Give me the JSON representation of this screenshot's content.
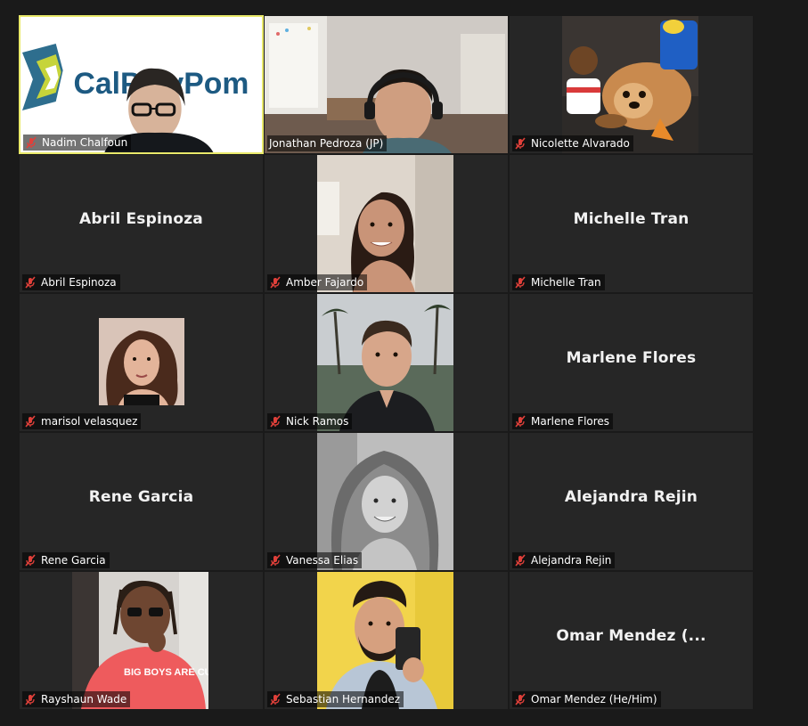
{
  "participants": [
    {
      "display_name": "Nadim Chalfoun",
      "center_text": "",
      "mic_icon": "mic-muted-icon",
      "active_speaker": true
    },
    {
      "display_name": "Jonathan Pedroza (JP)",
      "center_text": "",
      "mic_icon": "mic-muted-icon"
    },
    {
      "display_name": "Nicolette Alvarado",
      "center_text": "",
      "mic_icon": "mic-muted-icon"
    },
    {
      "display_name": "Abril Espinoza",
      "center_text": "Abril Espinoza",
      "mic_icon": "mic-muted-icon"
    },
    {
      "display_name": "Amber Fajardo",
      "center_text": "",
      "mic_icon": "mic-muted-icon"
    },
    {
      "display_name": "Michelle Tran",
      "center_text": "Michelle Tran",
      "mic_icon": "mic-muted-icon"
    },
    {
      "display_name": "marisol velasquez",
      "center_text": "",
      "mic_icon": "mic-muted-icon"
    },
    {
      "display_name": "Nick Ramos",
      "center_text": "",
      "mic_icon": "mic-muted-icon"
    },
    {
      "display_name": "Marlene Flores",
      "center_text": "Marlene Flores",
      "mic_icon": "mic-muted-icon"
    },
    {
      "display_name": "Rene Garcia",
      "center_text": "Rene Garcia",
      "mic_icon": "mic-muted-icon"
    },
    {
      "display_name": "Vanessa Elias",
      "center_text": "",
      "mic_icon": "mic-muted-icon"
    },
    {
      "display_name": "Alejandra Rejin",
      "center_text": "Alejandra Rejin",
      "mic_icon": "mic-muted-icon"
    },
    {
      "display_name": "Rayshaun Wade",
      "center_text": "",
      "mic_icon": "mic-muted-icon"
    },
    {
      "display_name": "Sebastian Hernandez",
      "center_text": "",
      "mic_icon": "mic-muted-icon"
    },
    {
      "display_name": "Omar Mendez (He/Him)",
      "center_text": "Omar Mendez (...",
      "mic_icon": "mic-muted-icon"
    }
  ],
  "virtual_background_text": "CalPolyPom",
  "shirt_text": "BIG BOYS ARE CUTE",
  "colors": {
    "background": "#1a1a1a",
    "tile": "#262626",
    "active_border": "#e9e96a",
    "muted_red": "#e0403a"
  }
}
